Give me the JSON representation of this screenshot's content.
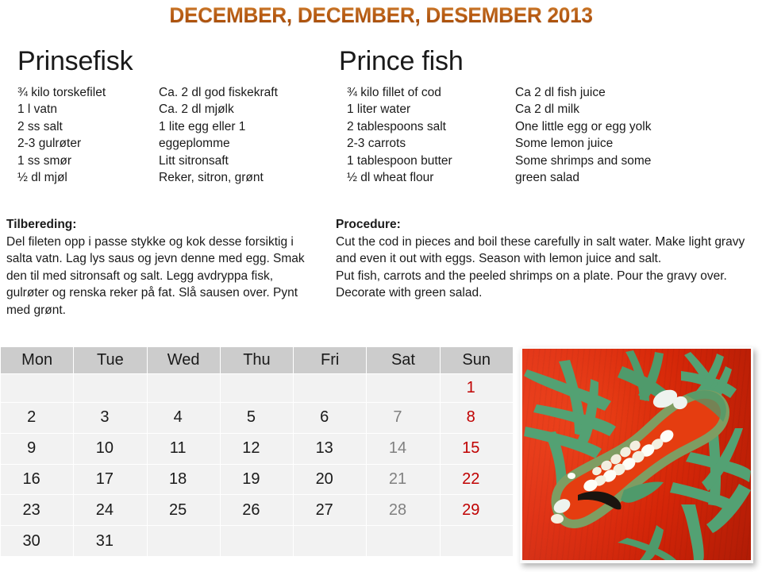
{
  "title": "DECEMBER, DECEMBER, DESEMBER 2013",
  "title_color": "#cd6a1b",
  "recipe_no": {
    "heading": "Prinsefisk",
    "ingredients_col1": [
      "¾ kilo torskefilet",
      "1 l vatn",
      "2 ss salt",
      "2-3 gulrøter",
      "1 ss smør",
      "½ dl mjøl"
    ],
    "ingredients_col2": [
      "Ca. 2 dl god fiskekraft",
      "Ca. 2 dl mjølk",
      "1 lite egg eller 1",
      "eggeplomme",
      "Litt sitronsaft",
      "Reker, sitron, grønt"
    ],
    "procedure_title": "Tilbereding:",
    "procedure_text": "Del fileten opp i passe stykke og kok desse forsiktig i salta vatn. Lag lys saus og jevn denne med egg. Smak den til med sitronsaft og salt. Legg avdryppa fisk, gulrøter og renska reker på fat. Slå sausen over. Pynt med grønt."
  },
  "recipe_en": {
    "heading": "Prince fish",
    "ingredients_col1": [
      "¾ kilo fillet of cod",
      "1 liter water",
      "2 tablespoons salt",
      "2-3 carrots",
      "1 tablespoon butter",
      "½ dl wheat flour"
    ],
    "ingredients_col2": [
      "Ca 2 dl fish juice",
      "Ca 2 dl milk",
      "One little egg or egg yolk",
      "Some lemon juice",
      "Some shrimps and some",
      "green salad"
    ],
    "procedure_title": "Procedure:",
    "procedure_text": "Cut the cod in pieces and boil these carefully in salt water. Make light gravy and even it out with eggs. Season with lemon juice and salt.",
    "procedure_text2": "Put fish, carrots and the peeled shrimps on a plate. Pour the gravy over. Decorate with green salad."
  },
  "calendar": {
    "weekday_headers": [
      "Mon",
      "Tue",
      "Wed",
      "Thu",
      "Fri",
      "Sat",
      "Sun"
    ],
    "saturday_color": "#808080",
    "sunday_color": "#c00000",
    "header_bg": "#cccccc",
    "cell_bg": "#f2f2f2",
    "weeks": [
      [
        "",
        "",
        "",
        "",
        "",
        "",
        "1"
      ],
      [
        "2",
        "3",
        "4",
        "5",
        "6",
        "7",
        "8"
      ],
      [
        "9",
        "10",
        "11",
        "12",
        "13",
        "14",
        "15"
      ],
      [
        "16",
        "17",
        "18",
        "19",
        "20",
        "21",
        "22"
      ],
      [
        "23",
        "24",
        "25",
        "26",
        "27",
        "28",
        "29"
      ],
      [
        "30",
        "31",
        "",
        "",
        "",
        "",
        ""
      ]
    ]
  },
  "painting": {
    "name": "childrens-fish-painting",
    "background_color": "#e8290b",
    "plant_color": "#53a173",
    "fish_outline_color": "#87a86b"
  }
}
